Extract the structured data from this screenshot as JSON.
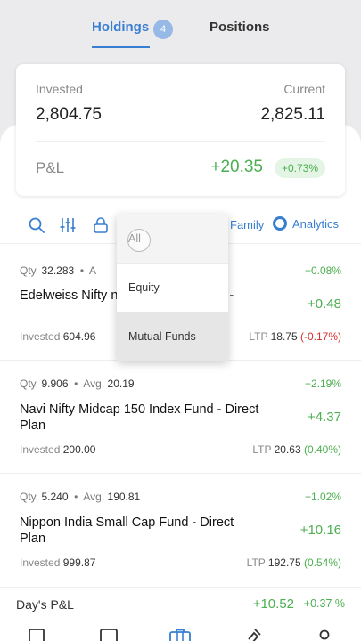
{
  "tabs": {
    "holdings_label": "Holdings",
    "holdings_count": "4",
    "positions_label": "Positions"
  },
  "summary": {
    "invested_label": "Invested",
    "invested_value": "2,804.75",
    "current_label": "Current",
    "current_value": "2,825.11",
    "pnl_label": "P&L",
    "pnl_value": "+20.35",
    "pnl_percent": "+0.73%"
  },
  "toolbar": {
    "family_label": "Family",
    "analytics_label": "Analytics"
  },
  "dropdown": {
    "options": [
      "All",
      "Equity",
      "Mutual Funds"
    ]
  },
  "holdings": [
    {
      "qty_label": "Qty.",
      "qty": "32.283",
      "avg_label": "A",
      "name": "Edelweiss Nifty               ntum 50 Index Fund -",
      "change": "+0.08%",
      "pnl": "+0.48",
      "invested_label": "Invested",
      "invested": "604.96",
      "ltp_label": "LTP",
      "ltp": "18.75",
      "ltp_change": "(-0.17%)"
    },
    {
      "qty_label": "Qty.",
      "qty": "9.906",
      "avg_label": "Avg.",
      "avg": "20.19",
      "name": "Navi Nifty Midcap 150 Index Fund - Direct Plan",
      "change": "+2.19%",
      "pnl": "+4.37",
      "invested_label": "Invested",
      "invested": "200.00",
      "ltp_label": "LTP",
      "ltp": "20.63",
      "ltp_change": "(0.40%)"
    },
    {
      "qty_label": "Qty.",
      "qty": "5.240",
      "avg_label": "Avg.",
      "avg": "190.81",
      "name": "Nippon India Small Cap Fund - Direct Plan",
      "change": "+1.02%",
      "pnl": "+10.16",
      "invested_label": "Invested",
      "invested": "999.87",
      "ltp_label": "LTP",
      "ltp": "192.75",
      "ltp_change": "(0.54%)"
    }
  ],
  "day_pnl": {
    "label": "Day's P&L",
    "value": "+10.52",
    "percent": "+0.37 %"
  },
  "nav": {
    "items": [
      "watchlist-icon",
      "orders-icon",
      "portfolio-icon",
      "bids-icon",
      "account-icon"
    ],
    "active_color": "#387ed1"
  },
  "colors": {
    "accent": "#387ed1",
    "positive": "#4caf50",
    "negative": "#d32f2f"
  }
}
